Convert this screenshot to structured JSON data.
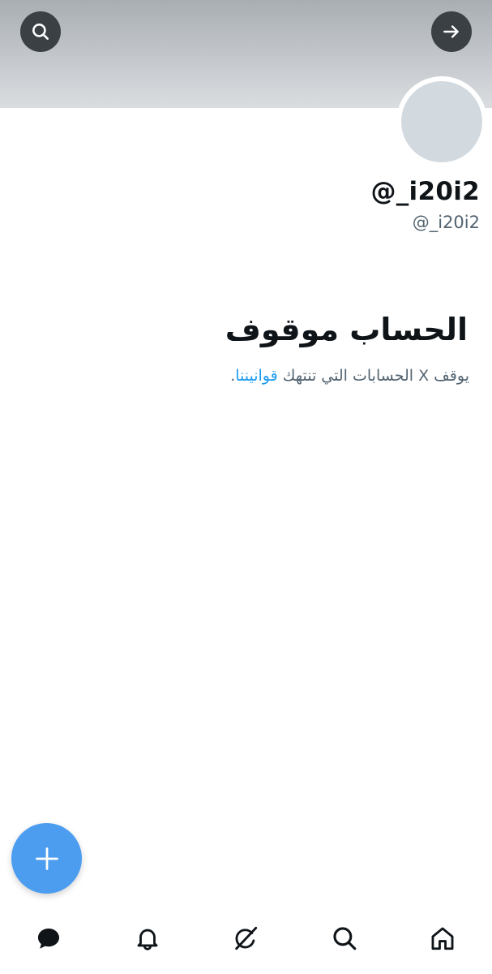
{
  "profile": {
    "display_name": "@_i20i2",
    "handle": "@_i20i2"
  },
  "suspension": {
    "title": "الحساب موقوف",
    "description_prefix": "يوقف X الحسابات التي تنتهك ",
    "rules_link": "قوانيننا",
    "description_suffix": "."
  },
  "icons": {
    "header_left": "search-icon",
    "header_right": "arrow-right-icon",
    "fab": "plus-icon",
    "nav": [
      "messages-icon",
      "notifications-icon",
      "grok-icon",
      "search-icon",
      "home-icon"
    ]
  },
  "colors": {
    "accent": "#1d9bf0",
    "fab": "#4c9df0",
    "secondary_text": "#536471"
  }
}
